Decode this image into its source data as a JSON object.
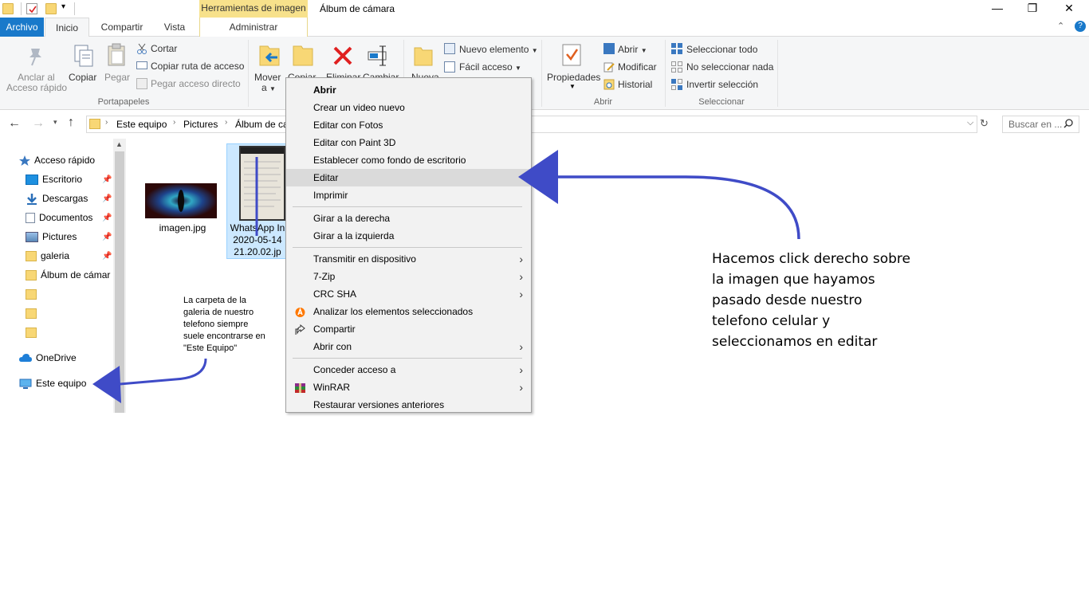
{
  "titlebar": {
    "context_tab": "Herramientas de imagen",
    "window_title": "Álbum de cámara",
    "minimize": "—",
    "restore": "❐",
    "close": "✕"
  },
  "tabs": {
    "file": "Archivo",
    "home": "Inicio",
    "share": "Compartir",
    "view": "Vista",
    "manage": "Administrar"
  },
  "ribbon": {
    "pin_quick_access": [
      "Anclar al",
      "Acceso rápido"
    ],
    "copy": "Copiar",
    "paste": "Pegar",
    "cut": "Cortar",
    "copy_path": "Copiar ruta de acceso",
    "paste_shortcut": "Pegar acceso directo",
    "clipboard_group": "Portapapeles",
    "move_to": [
      "Mover",
      "a"
    ],
    "copy_to": "Copiar",
    "delete": "Eliminar",
    "rename": "Cambiar",
    "new_folder": "Nueva",
    "new_item": "Nuevo elemento",
    "easy_access": "Fácil acceso",
    "properties": "Propiedades",
    "open": "Abrir",
    "edit": "Modificar",
    "history": "Historial",
    "open_group": "Abrir",
    "select_all": "Seleccionar todo",
    "select_none": "No seleccionar nada",
    "invert_selection": "Invertir selección",
    "select_group": "Seleccionar"
  },
  "address": {
    "crumbs": [
      "Este equipo",
      "Pictures",
      "Álbum de ca"
    ],
    "search_placeholder": "Buscar en ..."
  },
  "nav": {
    "quick_access": "Acceso rápido",
    "items": [
      {
        "label": "Escritorio",
        "pinned": true
      },
      {
        "label": "Descargas",
        "pinned": true
      },
      {
        "label": "Documentos",
        "pinned": true
      },
      {
        "label": "Pictures",
        "pinned": true
      },
      {
        "label": "galeria",
        "pinned": true
      },
      {
        "label": "Álbum de cámar",
        "pinned": false
      },
      {
        "label": "",
        "pinned": false
      },
      {
        "label": "",
        "pinned": false
      },
      {
        "label": "",
        "pinned": false
      }
    ],
    "onedrive": "OneDrive",
    "this_pc": "Este equipo"
  },
  "files": [
    {
      "name_lines": [
        "imagen.jpg"
      ]
    },
    {
      "name_lines": [
        "WhatsApp In",
        "2020-05-14",
        "21.20.02.jp"
      ]
    }
  ],
  "context_menu": {
    "items": [
      {
        "label": "Abrir",
        "bold": true,
        "submenu": false
      },
      {
        "label": "Crear un video nuevo",
        "submenu": false
      },
      {
        "label": "Editar con Fotos",
        "submenu": false
      },
      {
        "label": "Editar con Paint 3D",
        "submenu": false
      },
      {
        "label": "Establecer como fondo de escritorio",
        "submenu": false
      },
      {
        "label": "Editar",
        "highlighted": true,
        "submenu": false
      },
      {
        "label": "Imprimir",
        "submenu": false
      },
      {
        "label": "Girar a la derecha",
        "submenu": false
      },
      {
        "label": "Girar a la izquierda",
        "submenu": false
      },
      {
        "label": "Transmitir en dispositivo",
        "submenu": true
      },
      {
        "label": "7-Zip",
        "submenu": true
      },
      {
        "label": "CRC SHA",
        "submenu": true
      },
      {
        "label": "Analizar los elementos seleccionados",
        "submenu": false
      },
      {
        "label": "Compartir",
        "submenu": false
      },
      {
        "label": "Abrir con",
        "submenu": true
      },
      {
        "label": "Conceder acceso a",
        "submenu": true
      },
      {
        "label": "WinRAR",
        "submenu": true
      },
      {
        "label": "Restaurar versiones anteriores",
        "submenu": false
      }
    ]
  },
  "annotations": {
    "main": [
      "Hacemos click derecho sobre",
      "la imagen que hayamos",
      "pasado desde nuestro",
      "telefono celular y",
      "seleccionamos en editar"
    ],
    "small": [
      "La carpeta de la",
      "galeria de nuestro",
      "telefono siempre",
      "suele encontrarse en",
      "\"Este Equipo\""
    ]
  },
  "colors": {
    "accent": "#1979ca",
    "context_tab": "#f7e18b",
    "annotation_arrow": "#3f4bc7",
    "selection": "#cce8ff"
  }
}
